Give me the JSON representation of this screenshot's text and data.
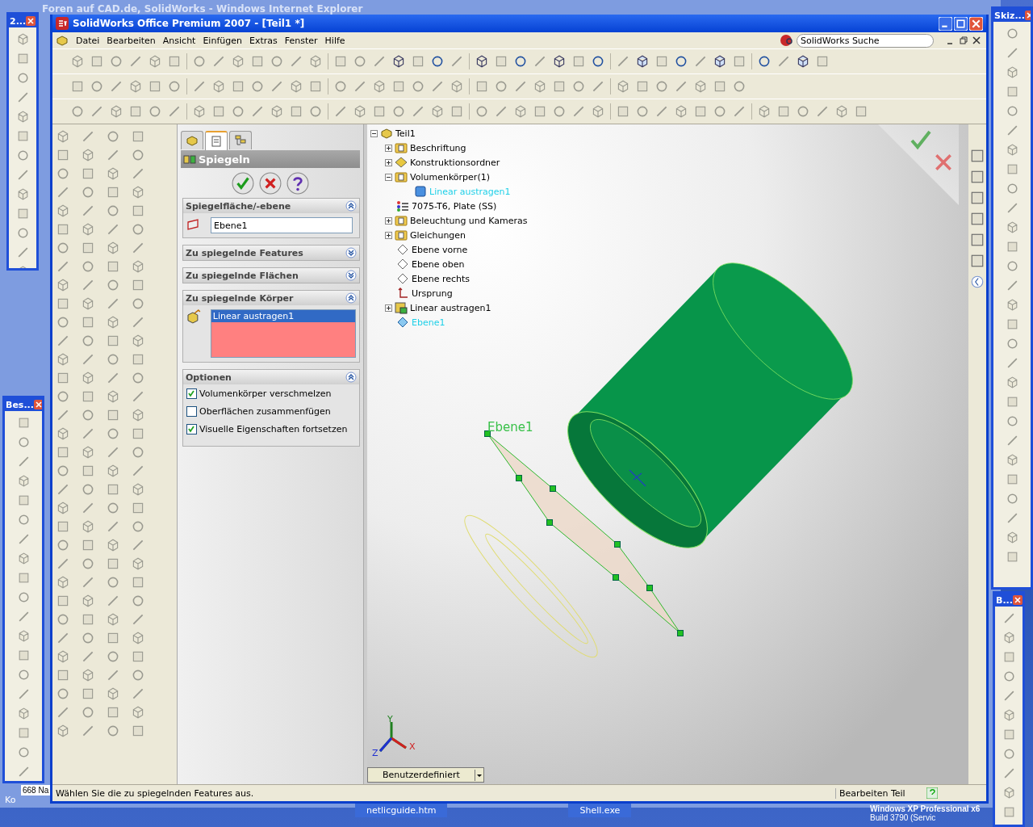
{
  "background_window": {
    "title": "Foren auf CAD.de, SolidWorks - Windows Internet Explorer"
  },
  "floating_toolbars": [
    {
      "title": "2..."
    },
    {
      "title": "Bes..."
    },
    {
      "title": "Skiz..."
    },
    {
      "title": "B..."
    }
  ],
  "window": {
    "title": "SolidWorks Office Premium 2007 - [Teil1 *]"
  },
  "menu": [
    "Datei",
    "Bearbeiten",
    "Ansicht",
    "Einfügen",
    "Extras",
    "Fenster",
    "Hilfe"
  ],
  "search": {
    "placeholder": "SolidWorks Suche"
  },
  "panel_tabs": [
    {
      "kind": "tree",
      "selected": false
    },
    {
      "kind": "properties",
      "selected": true
    },
    {
      "kind": "config",
      "selected": false
    }
  ],
  "property_manager": {
    "title": "Spiegeln",
    "sections": [
      {
        "kind": "field",
        "title": "Spiegelfläche/-ebene",
        "expanded": true,
        "value": "Ebene1"
      },
      {
        "title": "Zu spiegelnde Features",
        "expanded": false
      },
      {
        "title": "Zu spiegelnde Flächen",
        "expanded": false
      },
      {
        "kind": "list",
        "title": "Zu spiegelnde Körper",
        "expanded": true,
        "items": [
          {
            "label": "Linear austragen1",
            "selected": true
          }
        ]
      },
      {
        "kind": "options",
        "title": "Optionen",
        "expanded": true,
        "options": [
          {
            "label": "Volumenkörper verschmelzen",
            "checked": true
          },
          {
            "label": "Oberflächen zusammenfügen",
            "checked": false
          },
          {
            "label": "Visuelle Eigenschaften fortsetzen",
            "checked": true
          }
        ]
      }
    ]
  },
  "feature_tree": {
    "label": "Teil1",
    "expanded": true,
    "children": [
      {
        "kind": "annotation",
        "label": "Beschriftung",
        "expanded": false,
        "selected": false
      },
      {
        "kind": "design",
        "label": "Konstruktionsordner",
        "expanded": false,
        "selected": false
      },
      {
        "kind": "bodies",
        "label": "Volumenkörper(1)",
        "expanded": true,
        "selected": false,
        "children": [
          {
            "kind": "body",
            "label": "Linear austragen1",
            "selected": true
          }
        ]
      },
      {
        "kind": "material",
        "label": "7075-T6, Plate (SS)",
        "selected": false
      },
      {
        "kind": "lights",
        "label": "Beleuchtung und Kameras",
        "expanded": false,
        "selected": false
      },
      {
        "kind": "equations",
        "label": "Gleichungen",
        "expanded": false,
        "selected": false
      },
      {
        "kind": "plane",
        "label": "Ebene vorne",
        "selected": false
      },
      {
        "kind": "plane",
        "label": "Ebene oben",
        "selected": false
      },
      {
        "kind": "plane",
        "label": "Ebene rechts",
        "selected": false
      },
      {
        "kind": "origin",
        "label": "Ursprung",
        "selected": false
      },
      {
        "kind": "extrude",
        "label": "Linear austragen1",
        "expanded": false,
        "selected": false
      },
      {
        "kind": "refplane",
        "label": "Ebene1",
        "selected": true
      }
    ]
  },
  "viewport": {
    "plane_label": "Ebene1",
    "triad": [
      "X",
      "Y",
      "Z"
    ],
    "view_dropdown": "Benutzerdefiniert"
  },
  "status_bar": {
    "message": "Wählen Sie die zu spiegelnden Features aus.",
    "mode": "Bearbeiten Teil"
  },
  "taskbar": {
    "left_labels": [
      "Ko",
      "668 Na"
    ],
    "items": [
      "netlicguide.htm",
      "Shell.exe"
    ],
    "os_lines": [
      "Windows XP Professional x6",
      "Build 3790 (Servic"
    ]
  }
}
